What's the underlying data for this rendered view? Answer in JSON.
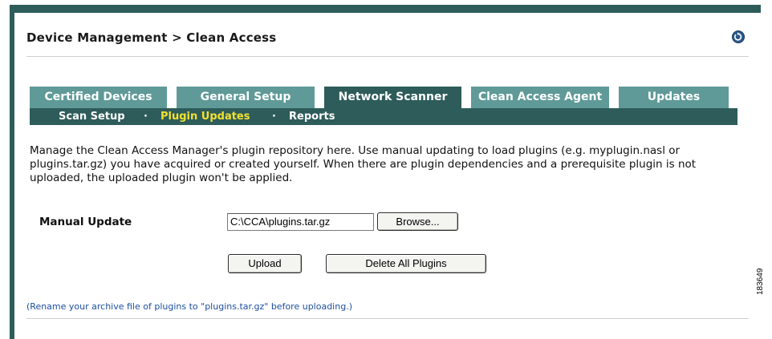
{
  "header": {
    "title": "Device Management > Clean Access"
  },
  "tabs": [
    {
      "label": "Certified Devices",
      "active": false
    },
    {
      "label": "General Setup",
      "active": false
    },
    {
      "label": "Network Scanner",
      "active": true
    },
    {
      "label": "Clean Access Agent",
      "active": false
    },
    {
      "label": "Updates",
      "active": false
    }
  ],
  "subtabs": [
    {
      "label": "Scan Setup",
      "active": false
    },
    {
      "label": "Plugin Updates",
      "active": true
    },
    {
      "label": "Reports",
      "active": false
    }
  ],
  "subtab_separator": "·",
  "description": "Manage the Clean Access Manager's plugin repository here. Use manual updating to load plugins (e.g. myplugin.nasl or plugins.tar.gz) you have acquired or created yourself. When there are plugin dependencies and a prerequisite plugin is not uploaded, the uploaded plugin won't be applied.",
  "form": {
    "manual_update_label": "Manual Update",
    "file_value": "C:\\CCA\\plugins.tar.gz",
    "browse_label": "Browse...",
    "upload_label": "Upload",
    "delete_all_label": "Delete All Plugins"
  },
  "note": "(Rename your archive file of plugins to \"plugins.tar.gz\" before uploading.)",
  "figure_number": "183649",
  "colors": {
    "frame": "#2e5c5a",
    "tab_inactive": "#5f9a98",
    "tab_active": "#2e5c5a",
    "subtab_active_text": "#f2e12e",
    "note_text": "#1c4fa0"
  },
  "icons": {
    "refresh": "refresh-icon"
  }
}
